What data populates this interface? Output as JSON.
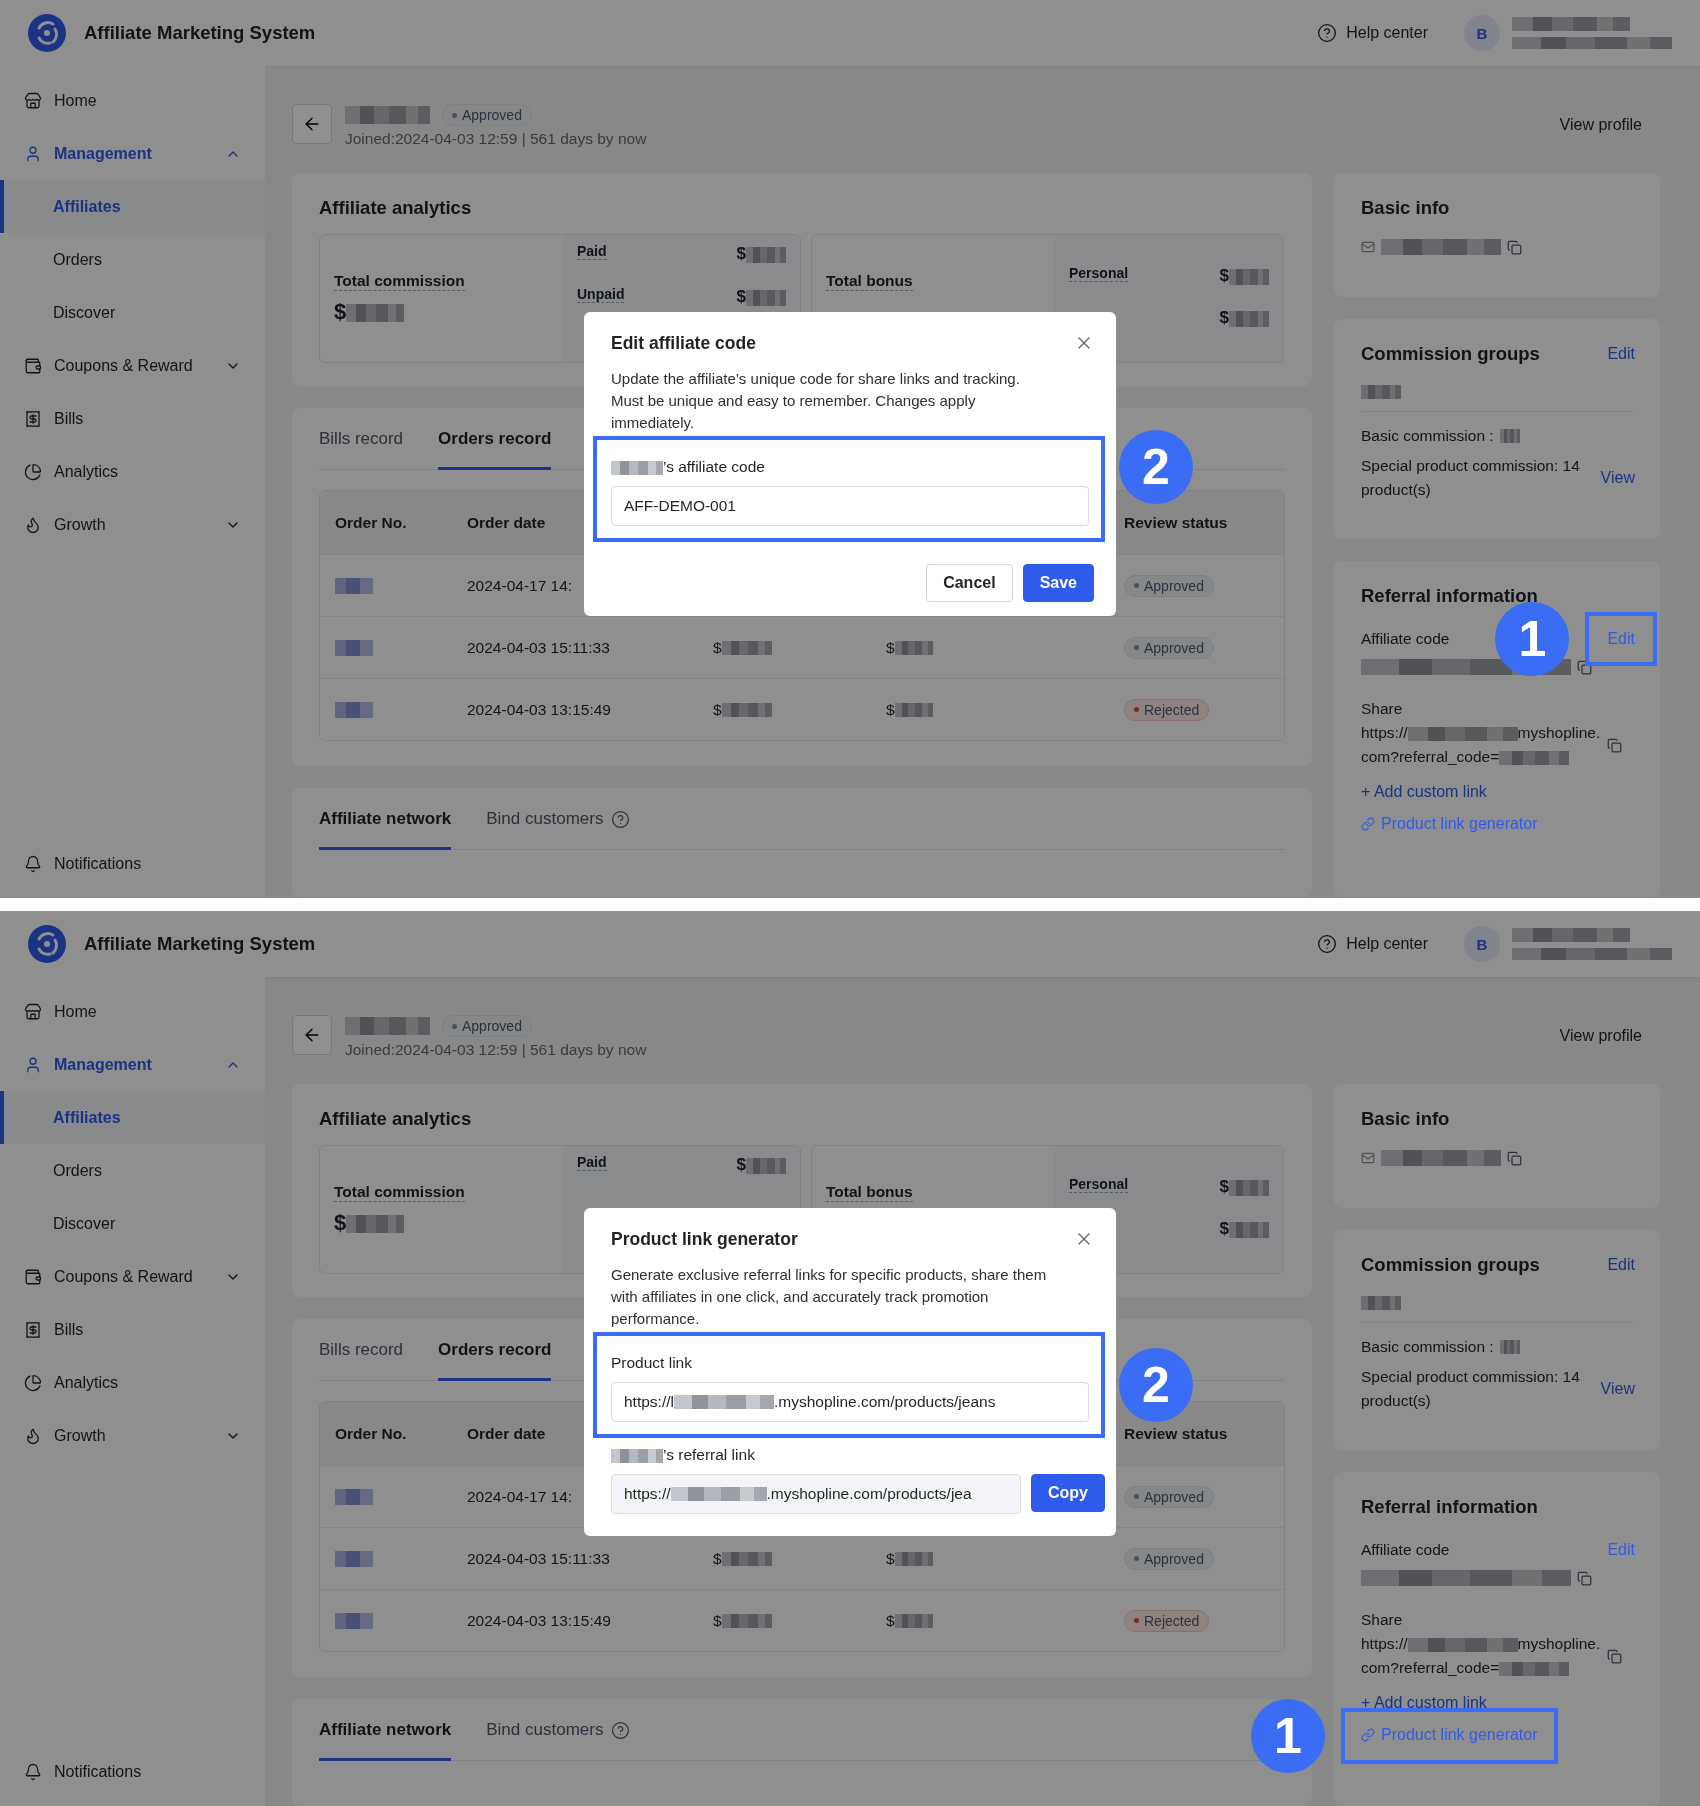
{
  "screens": [
    {
      "header": {
        "title": "Affiliate Marketing System",
        "help": "Help center",
        "avatar": "B"
      },
      "sidebar": {
        "items": [
          {
            "label": "Home",
            "kind": "link",
            "selected": false
          },
          {
            "label": "Management",
            "kind": "group",
            "selected": true,
            "expanded": true,
            "children": [
              {
                "label": "Affiliates",
                "selected": true
              },
              {
                "label": "Orders",
                "selected": false
              },
              {
                "label": "Discover",
                "selected": false
              }
            ]
          },
          {
            "label": "Coupons & Reward",
            "kind": "group",
            "selected": false,
            "expanded": false
          },
          {
            "label": "Bills",
            "kind": "link",
            "selected": false
          },
          {
            "label": "Analytics",
            "kind": "link",
            "selected": false
          },
          {
            "label": "Growth",
            "kind": "group",
            "selected": false,
            "expanded": false
          }
        ],
        "footer": "Notifications"
      },
      "profile": {
        "status": "Approved",
        "joined": "Joined:2024-04-03 12:59 | 561 days by now",
        "view_profile": "View profile"
      },
      "analytics": {
        "title": "Affiliate analytics",
        "boxes": [
          {
            "label": "Total commission",
            "value": "$",
            "rows": [
              {
                "label": "Paid",
                "value": "$"
              },
              {
                "label": "Unpaid",
                "value": "$"
              }
            ]
          },
          {
            "label": "Total bonus",
            "rows": [
              {
                "label": "Personal",
                "value": "$"
              },
              {
                "value": "$"
              }
            ]
          }
        ]
      },
      "orders": {
        "tabs": [
          {
            "label": "Bills record",
            "selected": false
          },
          {
            "label": "Orders record",
            "selected": true
          }
        ],
        "columns": [
          "Order No.",
          "Order date",
          "Review status"
        ],
        "rows": [
          {
            "date": "2024-04-17 14:",
            "status": "Approved",
            "kind": "approved"
          },
          {
            "date": "2024-04-03 15:11:33",
            "amount": "$",
            "bonus": "$",
            "status": "Approved",
            "kind": "approved"
          },
          {
            "date": "2024-04-03 13:15:49",
            "amount": "$",
            "bonus": "$",
            "status": "Rejected",
            "kind": "rejected"
          }
        ]
      },
      "network": {
        "tabs": [
          {
            "label": "Affiliate network",
            "selected": true
          },
          {
            "label": "Bind customers",
            "selected": false
          }
        ]
      },
      "basic_info": {
        "title": "Basic info"
      },
      "commission_groups": {
        "title": "Commission groups",
        "edit": "Edit",
        "basic": "Basic commission :",
        "special": "Special product commission: 14 product(s)",
        "view": "View"
      },
      "referral": {
        "title": "Referral information",
        "code_label": "Affiliate code",
        "edit": "Edit",
        "edit_highlighted": true,
        "share_label": "Share",
        "share_start": "https://",
        "share_mid": "myshopline.",
        "share_end": "com?referral_code=",
        "add_link": "+ Add custom link",
        "generator": "Product link generator",
        "generator_highlighted": false
      },
      "step_badges": [
        "1",
        "2"
      ],
      "modal": {
        "kind": "edit_code",
        "title": "Edit affiliate code",
        "description": "Update the affiliate’s unique code for share links and tracking. Must be unique and easy to remember. Changes apply immediately.",
        "field_highlighted": true,
        "field_label": "’s affiliate code",
        "value": "AFF-DEMO-001",
        "buttons": [
          {
            "label": "Cancel",
            "kind": "default"
          },
          {
            "label": "Save",
            "kind": "primary"
          }
        ]
      }
    },
    {
      "header": {
        "title": "Affiliate Marketing System",
        "help": "Help center",
        "avatar": "B"
      },
      "sidebar": {
        "items": [
          {
            "label": "Home",
            "kind": "link",
            "selected": false
          },
          {
            "label": "Management",
            "kind": "group",
            "selected": true,
            "expanded": true,
            "children": [
              {
                "label": "Affiliates",
                "selected": true
              },
              {
                "label": "Orders",
                "selected": false
              },
              {
                "label": "Discover",
                "selected": false
              }
            ]
          },
          {
            "label": "Coupons & Reward",
            "kind": "group",
            "selected": false,
            "expanded": false
          },
          {
            "label": "Bills",
            "kind": "link",
            "selected": false
          },
          {
            "label": "Analytics",
            "kind": "link",
            "selected": false
          },
          {
            "label": "Growth",
            "kind": "group",
            "selected": false,
            "expanded": false
          }
        ],
        "footer": "Notifications"
      },
      "profile": {
        "status": "Approved",
        "joined": "Joined:2024-04-03 12:59 | 561 days by now",
        "view_profile": "View profile"
      },
      "analytics": {
        "title": "Affiliate analytics",
        "boxes": [
          {
            "label": "Total commission",
            "value": "$",
            "rows": [
              {
                "label": "Paid",
                "value": "$"
              }
            ]
          },
          {
            "label": "Total bonus",
            "rows": [
              {
                "label": "Personal",
                "value": "$"
              },
              {
                "value": "$"
              }
            ]
          }
        ]
      },
      "orders": {
        "tabs": [
          {
            "label": "Bills record",
            "selected": false
          },
          {
            "label": "Orders record",
            "selected": true
          }
        ],
        "columns": [
          "Order No.",
          "Order date",
          "Review status"
        ],
        "rows": [
          {
            "date": "2024-04-17 14:",
            "status": "Approved",
            "kind": "approved"
          },
          {
            "date": "2024-04-03 15:11:33",
            "amount": "$",
            "bonus": "$",
            "status": "Approved",
            "kind": "approved"
          },
          {
            "date": "2024-04-03 13:15:49",
            "amount": "$",
            "bonus": "$",
            "status": "Rejected",
            "kind": "rejected"
          }
        ]
      },
      "network": {
        "tabs": [
          {
            "label": "Affiliate network",
            "selected": true
          },
          {
            "label": "Bind customers",
            "selected": false
          }
        ]
      },
      "basic_info": {
        "title": "Basic info"
      },
      "commission_groups": {
        "title": "Commission groups",
        "edit": "Edit",
        "basic": "Basic commission :",
        "special": "Special product commission: 14 product(s)",
        "view": "View"
      },
      "referral": {
        "title": "Referral information",
        "code_label": "Affiliate code",
        "edit": "Edit",
        "edit_highlighted": false,
        "share_label": "Share",
        "share_start": "https://",
        "share_mid": "myshopline.",
        "share_end": "com?referral_code=",
        "add_link": "+ Add custom link",
        "generator": "Product link generator",
        "generator_highlighted": true
      },
      "step_badges": [
        "1",
        "2"
      ],
      "modal": {
        "kind": "link_generator",
        "title": "Product link generator",
        "description": "Generate exclusive referral links for specific products, share them with affiliates in one click, and accurately track promotion performance.",
        "field_highlighted": true,
        "field_label": "Product link",
        "value_start": "https://l",
        "value_end": ".myshopline.com/products/jeans",
        "result_label": "’s referral link",
        "result_start": "https://",
        "result_end": ".myshopline.com/products/jea",
        "buttons": [
          {
            "label": "Copy",
            "kind": "primary"
          }
        ]
      }
    }
  ]
}
